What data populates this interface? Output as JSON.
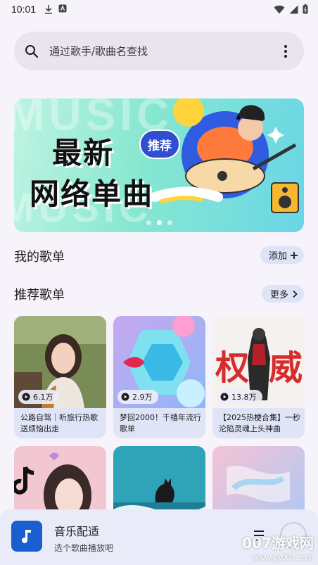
{
  "status_bar": {
    "time": "10:01"
  },
  "search": {
    "placeholder": "通过歌手/歌曲名查找"
  },
  "banner": {
    "line1": "最新",
    "line2": "网络单曲",
    "badge": "推荐",
    "watermark": "MUSIC",
    "active_dot": 1
  },
  "my_playlists": {
    "title": "我的歌单",
    "add_label": "添加"
  },
  "recommended": {
    "title": "推荐歌单",
    "more_label": "更多",
    "cards": [
      {
        "plays": "6.1万",
        "caption": "公路自驾｜听旅行热歌送烦恼出走"
      },
      {
        "plays": "2.9万",
        "caption": "梦回2000！千禧年流行歌单"
      },
      {
        "plays": "13.8万",
        "caption": "【2025热梗合集】一秒沦陷灵魂上头神曲"
      },
      {
        "plays": "",
        "caption": ""
      },
      {
        "plays": "",
        "caption": ""
      },
      {
        "plays": "",
        "caption": ""
      }
    ]
  },
  "player": {
    "title": "音乐配适",
    "subtitle": "选个歌曲播放吧"
  },
  "site_watermark": {
    "line1": "007游戏网",
    "line2": "www.yx007.com"
  },
  "colors": {
    "accent": "#1a5fd0",
    "pill": "#dfe3f7",
    "search_bg": "#e9e4ee"
  }
}
